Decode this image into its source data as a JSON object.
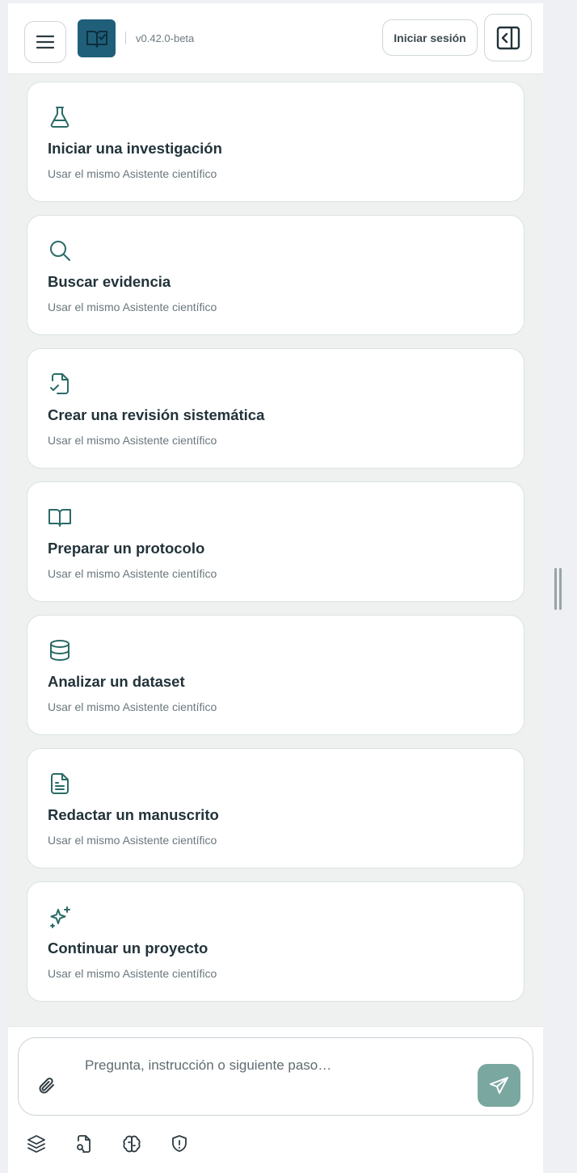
{
  "header": {
    "menu_icon": "hamburger-icon",
    "logo_icon": "book-check-icon",
    "version": "v0.42.0-beta",
    "login_label": "Iniciar sesión",
    "panel_icon": "panel-left-close-icon"
  },
  "cards": [
    {
      "icon": "flask-icon",
      "title": "Iniciar una investigación",
      "subtitle": "Usar el mismo Asistente científico"
    },
    {
      "icon": "search-icon",
      "title": "Buscar evidencia",
      "subtitle": "Usar el mismo Asistente científico"
    },
    {
      "icon": "file-check-icon",
      "title": "Crear una revisión sistemática",
      "subtitle": "Usar el mismo Asistente científico"
    },
    {
      "icon": "book-open-icon",
      "title": "Preparar un protocolo",
      "subtitle": "Usar el mismo Asistente científico"
    },
    {
      "icon": "database-icon",
      "title": "Analizar un dataset",
      "subtitle": "Usar el mismo Asistente científico"
    },
    {
      "icon": "file-text-icon",
      "title": "Redactar un manuscrito",
      "subtitle": "Usar el mismo Asistente científico"
    },
    {
      "icon": "sparkles-icon",
      "title": "Continuar un proyecto",
      "subtitle": "Usar el mismo Asistente científico"
    }
  ],
  "composer": {
    "placeholder": "Pregunta, instrucción o siguiente paso…",
    "attach_icon": "paperclip-icon",
    "send_icon": "send-icon"
  },
  "toolbar": [
    "layers-icon",
    "file-search-icon",
    "brain-icon",
    "shield-alert-icon"
  ],
  "colors": {
    "accent": "#1f5f79",
    "icon": "#2a6b66",
    "send": "#7aa7a0",
    "card_bg": "#ffffff",
    "list_bg": "#eef1f0"
  }
}
